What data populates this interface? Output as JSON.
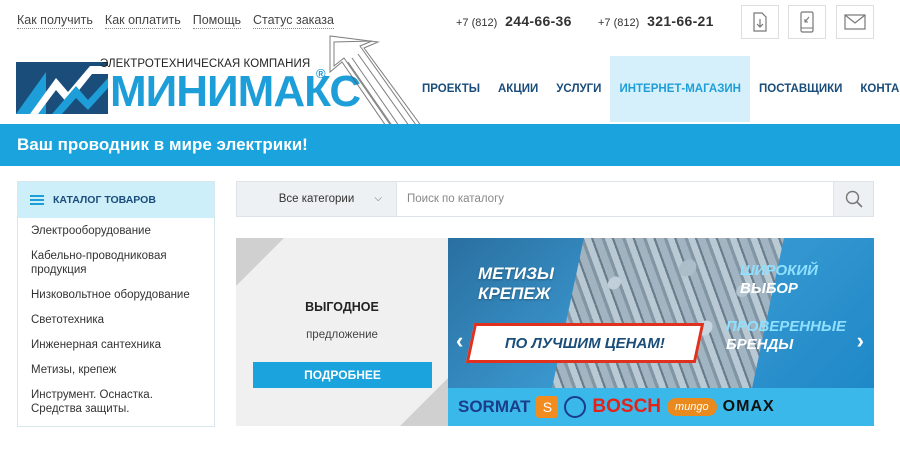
{
  "top_links": [
    "Как получить",
    "Как оплатить",
    "Помощь",
    "Статус заказа"
  ],
  "phones": [
    {
      "code": "+7 (812)",
      "number": "244-66-36"
    },
    {
      "code": "+7 (812)",
      "number": "321-66-21"
    }
  ],
  "header_icons": [
    "document-download-icon",
    "mobile-phone-icon",
    "envelope-icon"
  ],
  "logo": {
    "caption": "ЭЛЕКТРОТЕХНИЧЕСКАЯ КОМПАНИЯ",
    "word": "МИНИМАКС",
    "reg": "®"
  },
  "nav": {
    "items": [
      "ПРОЕКТЫ",
      "АКЦИИ",
      "УСЛУГИ",
      "ИНТЕРНЕТ-МАГАЗИН",
      "ПОСТАВЩИКИ",
      "КОНТАКТЫ"
    ],
    "active": "ИНТЕРНЕТ-МАГАЗИН"
  },
  "tagline": "Ваш проводник в мире электрики!",
  "catalog": {
    "title": "КАТАЛОГ ТОВАРОВ",
    "items": [
      "Электрооборудование",
      "Кабельно-проводниковая продукция",
      "Низковольтное оборудование",
      "Светотехника",
      "Инженерная сантехника",
      "Метизы, крепеж",
      "Инструмент. Оснастка. Средства защиты."
    ]
  },
  "search": {
    "category": "Все категории",
    "placeholder": "Поиск по каталогу"
  },
  "offer": {
    "title": "ВЫГОДНОЕ",
    "subtitle": "предложение",
    "button": "ПОДРОБНЕЕ"
  },
  "slider": {
    "left_line1": "МЕТИЗЫ",
    "left_line2": "КРЕПЕЖ",
    "right1_line1": "ШИРОКИЙ",
    "right1_line2": "ВЫБОР",
    "right2_line1": "ПРОВЕРЕННЫЕ",
    "right2_line2": "БРЕНДЫ",
    "banner": "ПО ЛУЧШИМ ЦЕНАМ!",
    "brands": [
      "SORMAT",
      "S",
      "BOSCH",
      "mungo",
      "OMAX"
    ]
  },
  "colors": {
    "accent": "#1aa3dd",
    "nav_text": "#1a4d7a",
    "active_bg": "#d6f0fb"
  }
}
